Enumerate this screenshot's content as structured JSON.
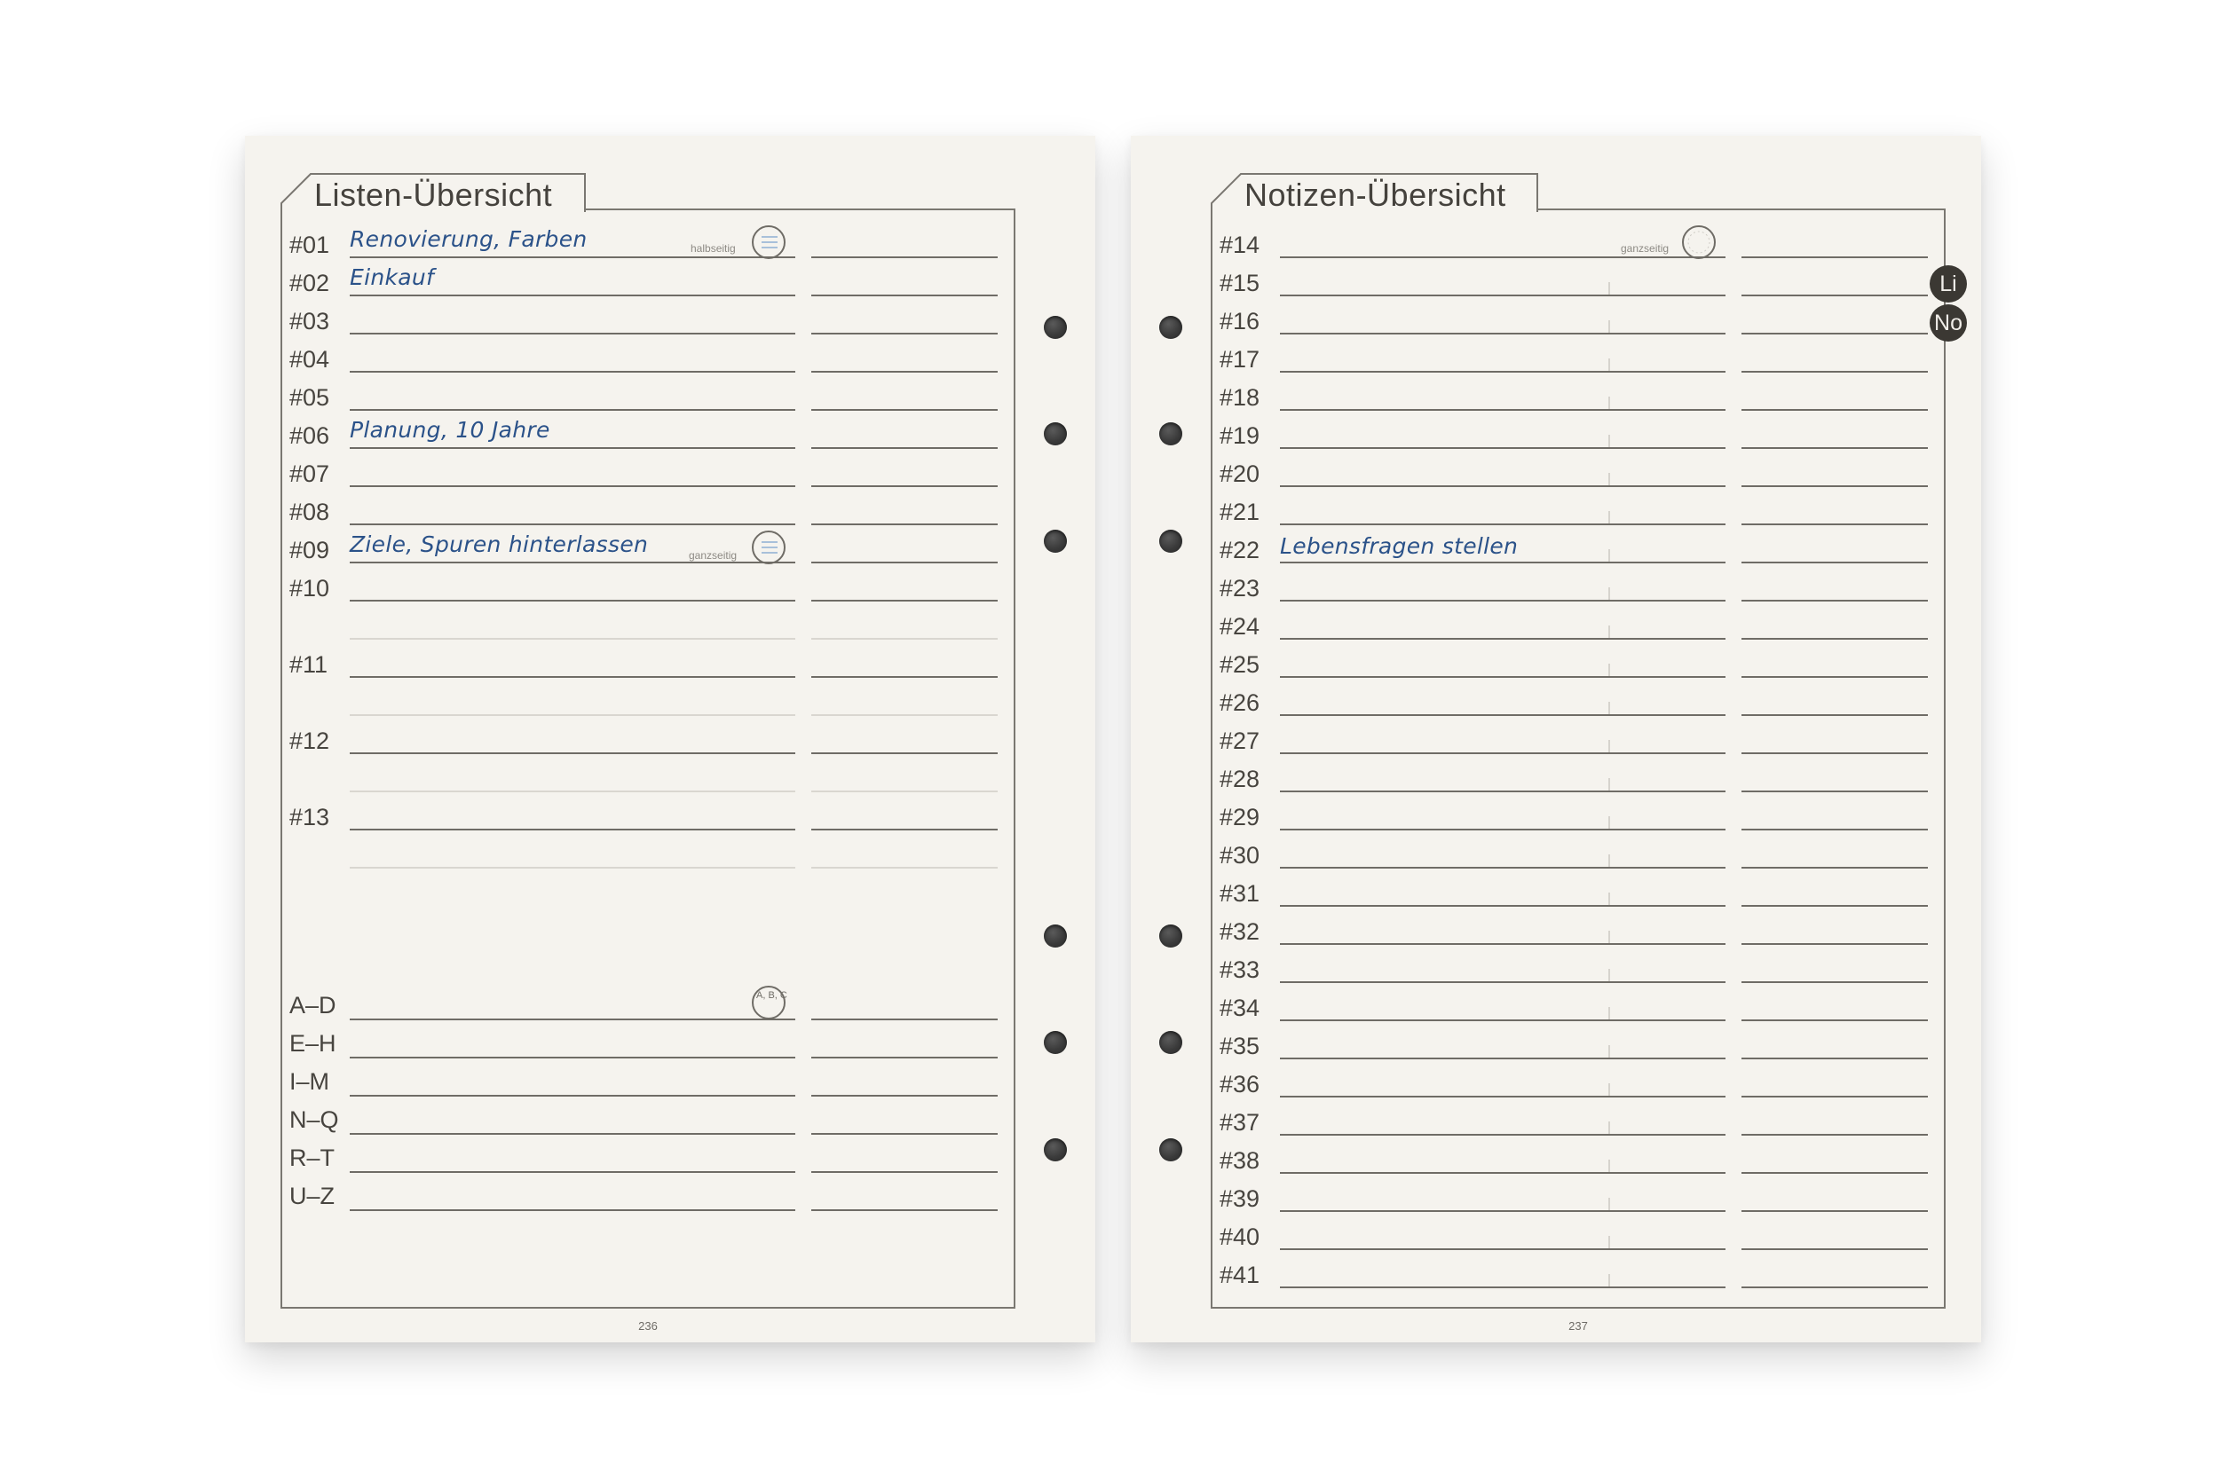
{
  "left_page": {
    "title": "Listen-Übersicht",
    "page_number": "236",
    "rows": [
      {
        "label": "#01",
        "entry": "Renovierung, Farben",
        "badge": "halbseitig"
      },
      {
        "label": "#02",
        "entry": "Einkauf"
      },
      {
        "label": "#03",
        "entry": ""
      },
      {
        "label": "#04",
        "entry": ""
      },
      {
        "label": "#05",
        "entry": ""
      },
      {
        "label": "#06",
        "entry": "Planung, 10 Jahre"
      },
      {
        "label": "#07",
        "entry": ""
      },
      {
        "label": "#08",
        "entry": ""
      },
      {
        "label": "#09",
        "entry": "Ziele, Spuren hinterlassen",
        "badge": "ganzseitig"
      },
      {
        "label": "#10",
        "entry": ""
      },
      {
        "label": "#11",
        "entry": ""
      },
      {
        "label": "#12",
        "entry": ""
      },
      {
        "label": "#13",
        "entry": ""
      }
    ],
    "index_rows": [
      {
        "label": "A–D",
        "badge_text": "A, B, C"
      },
      {
        "label": "E–H"
      },
      {
        "label": "I–M"
      },
      {
        "label": "N–Q"
      },
      {
        "label": "R–T"
      },
      {
        "label": "U–Z"
      }
    ]
  },
  "right_page": {
    "title": "Notizen-Übersicht",
    "page_number": "237",
    "badge": "ganzseitig",
    "rows": [
      {
        "label": "#14",
        "entry": ""
      },
      {
        "label": "#15",
        "entry": ""
      },
      {
        "label": "#16",
        "entry": ""
      },
      {
        "label": "#17",
        "entry": ""
      },
      {
        "label": "#18",
        "entry": ""
      },
      {
        "label": "#19",
        "entry": ""
      },
      {
        "label": "#20",
        "entry": ""
      },
      {
        "label": "#21",
        "entry": ""
      },
      {
        "label": "#22",
        "entry": "Lebensfragen stellen"
      },
      {
        "label": "#23",
        "entry": ""
      },
      {
        "label": "#24",
        "entry": ""
      },
      {
        "label": "#25",
        "entry": ""
      },
      {
        "label": "#26",
        "entry": ""
      },
      {
        "label": "#27",
        "entry": ""
      },
      {
        "label": "#28",
        "entry": ""
      },
      {
        "label": "#29",
        "entry": ""
      },
      {
        "label": "#30",
        "entry": ""
      },
      {
        "label": "#31",
        "entry": ""
      },
      {
        "label": "#32",
        "entry": ""
      },
      {
        "label": "#33",
        "entry": ""
      },
      {
        "label": "#34",
        "entry": ""
      },
      {
        "label": "#35",
        "entry": ""
      },
      {
        "label": "#36",
        "entry": ""
      },
      {
        "label": "#37",
        "entry": ""
      },
      {
        "label": "#38",
        "entry": ""
      },
      {
        "label": "#39",
        "entry": ""
      },
      {
        "label": "#40",
        "entry": ""
      },
      {
        "label": "#41",
        "entry": ""
      }
    ],
    "side_tabs": [
      {
        "label": "Li"
      },
      {
        "label": "No"
      }
    ]
  },
  "colors": {
    "paper": "#f5f3ee",
    "ink_print": "#47443f",
    "ink_handwriting": "#2b5289",
    "line": "#6f6c66",
    "side_tab": "#3b3833"
  }
}
